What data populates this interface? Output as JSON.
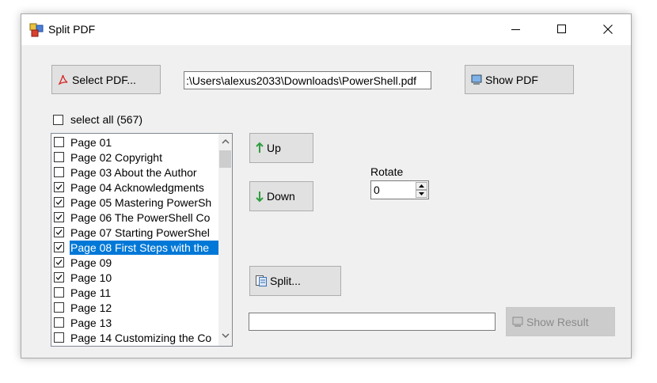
{
  "window": {
    "title": "Split PDF"
  },
  "toolbar": {
    "select_pdf_label": "Select PDF...",
    "file_path": ":\\Users\\alexus2033\\Downloads\\PowerShell.pdf",
    "show_pdf_label": "Show PDF"
  },
  "select_all": {
    "label": "select all (567)",
    "checked": false
  },
  "pages": [
    {
      "label": "Page 01",
      "checked": false,
      "selected": false
    },
    {
      "label": "Page 02 Copyright",
      "checked": false,
      "selected": false
    },
    {
      "label": "Page 03 About the Author",
      "checked": false,
      "selected": false
    },
    {
      "label": "Page 04 Acknowledgments",
      "checked": true,
      "selected": false
    },
    {
      "label": "Page 05 Mastering PowerSh",
      "checked": true,
      "selected": false
    },
    {
      "label": "Page 06 The PowerShell Co",
      "checked": true,
      "selected": false
    },
    {
      "label": "Page 07 Starting PowerShel",
      "checked": true,
      "selected": false
    },
    {
      "label": "Page 08 First Steps with the",
      "checked": true,
      "selected": true
    },
    {
      "label": "Page 09",
      "checked": true,
      "selected": false
    },
    {
      "label": "Page 10",
      "checked": true,
      "selected": false
    },
    {
      "label": "Page 11",
      "checked": false,
      "selected": false
    },
    {
      "label": "Page 12",
      "checked": false,
      "selected": false
    },
    {
      "label": "Page 13",
      "checked": false,
      "selected": false
    },
    {
      "label": "Page 14 Customizing the Co",
      "checked": false,
      "selected": false
    }
  ],
  "actions": {
    "up_label": "Up",
    "down_label": "Down",
    "rotate_label": "Rotate",
    "rotate_value": "0",
    "split_label": "Split...",
    "result_value": "",
    "show_result_label": "Show Result"
  },
  "colors": {
    "selection": "#0078d7",
    "arrow_green": "#2e9e3e",
    "pdf_red": "#d42020"
  }
}
